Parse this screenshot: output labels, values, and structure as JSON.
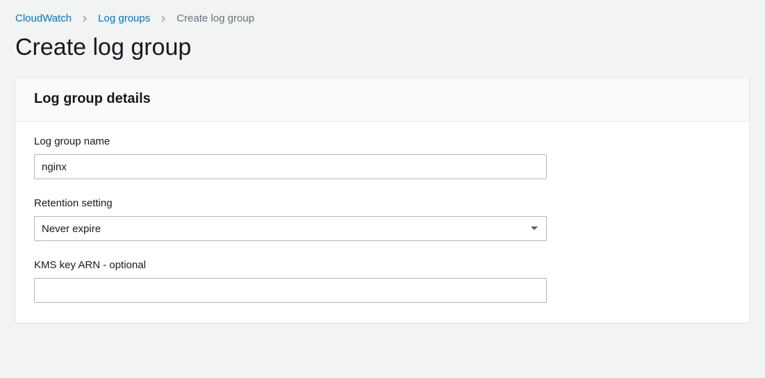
{
  "breadcrumb": {
    "item0": "CloudWatch",
    "item1": "Log groups",
    "current": "Create log group"
  },
  "pageTitle": "Create log group",
  "panel": {
    "title": "Log group details",
    "logGroupName": {
      "label": "Log group name",
      "value": "nginx"
    },
    "retention": {
      "label": "Retention setting",
      "selected": "Never expire"
    },
    "kms": {
      "label": "KMS key ARN - optional",
      "value": ""
    }
  }
}
